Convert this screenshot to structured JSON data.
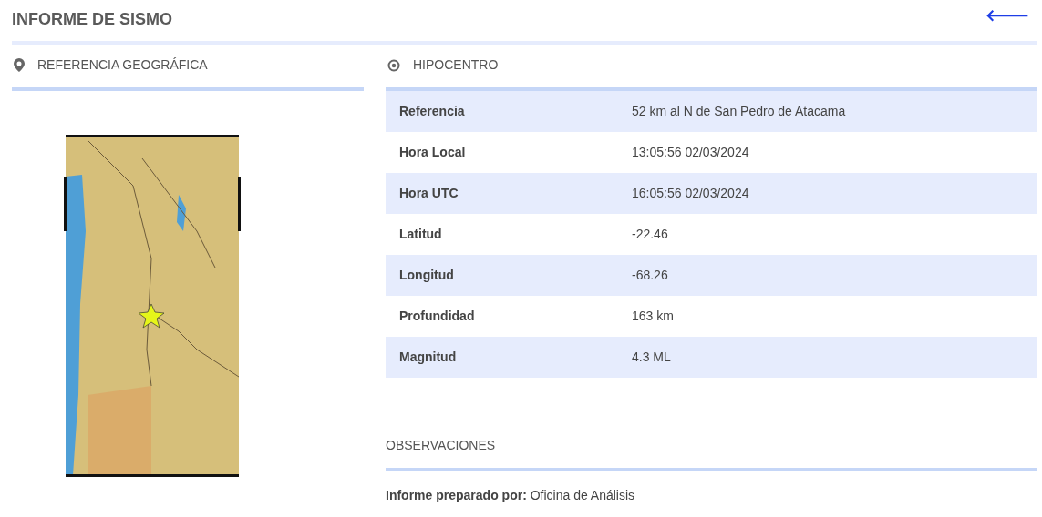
{
  "title": "INFORME DE SISMO",
  "back_button": {
    "label": "🡐"
  },
  "geo_section": {
    "title": "REFERENCIA GEOGRÁFICA"
  },
  "hypocenter": {
    "title": "HIPOCENTRO",
    "rows": [
      {
        "label": "Referencia",
        "value": "52 km al N de San Pedro de Atacama"
      },
      {
        "label": "Hora Local",
        "value": "13:05:56 02/03/2024"
      },
      {
        "label": "Hora UTC",
        "value": "16:05:56 02/03/2024"
      },
      {
        "label": "Latitud",
        "value": "-22.46"
      },
      {
        "label": "Longitud",
        "value": "-68.26"
      },
      {
        "label": "Profundidad",
        "value": "163 km"
      },
      {
        "label": "Magnitud",
        "value": "4.3 ML"
      }
    ]
  },
  "observations": {
    "title": "OBSERVACIONES",
    "text": "**Informe preparado por:** Oficina de Análisis"
  }
}
